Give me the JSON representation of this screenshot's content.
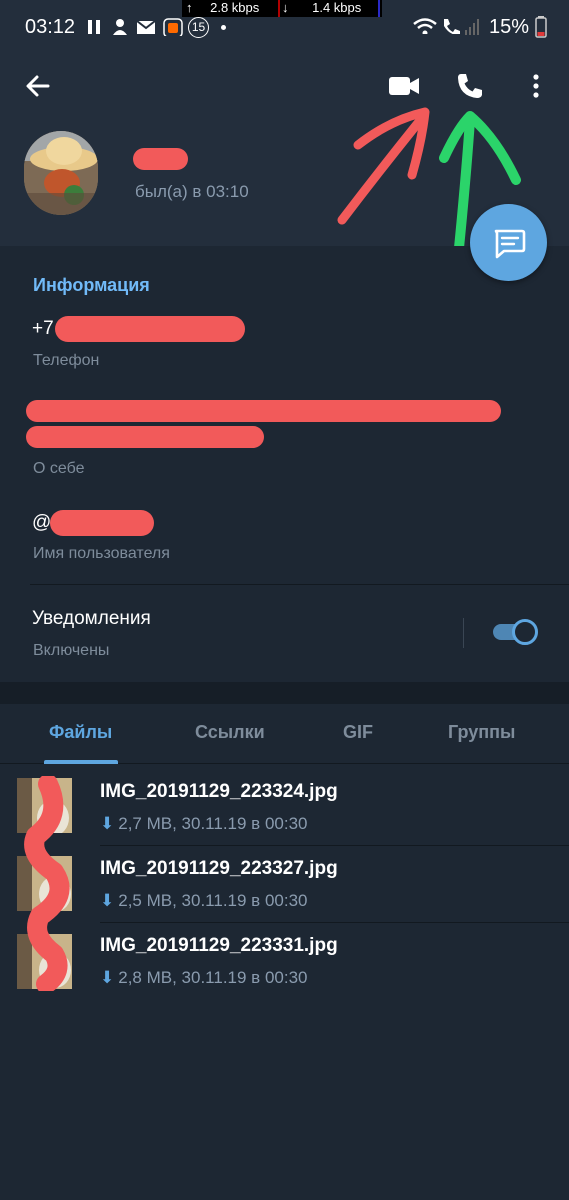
{
  "status_bar": {
    "time": "03:12",
    "upload_speed": "2.8 kbps",
    "download_speed": "1.4 kbps",
    "notification_count": "15",
    "battery": "15%"
  },
  "header": {
    "back_icon": "arrow-left-icon",
    "video_call_icon": "video-camera-icon",
    "voice_call_icon": "phone-icon",
    "more_icon": "more-vertical-icon",
    "last_seen": "был(а) в 03:10"
  },
  "info": {
    "section_title": "Информация",
    "phone_value": "+7",
    "phone_label": "Телефон",
    "bio_label": "О себе",
    "username_value": "@",
    "username_label": "Имя пользователя",
    "notifications_title": "Уведомления",
    "notifications_status": "Включены",
    "notifications_enabled": true
  },
  "tabs": [
    {
      "label": "Файлы",
      "active": true
    },
    {
      "label": "Ссылки",
      "active": false
    },
    {
      "label": "GIF",
      "active": false
    },
    {
      "label": "Группы",
      "active": false
    }
  ],
  "files": [
    {
      "name": "IMG_20191129_223324.jpg",
      "meta": "2,7 MB, 30.11.19 в 00:30"
    },
    {
      "name": "IMG_20191129_223327.jpg",
      "meta": "2,5 MB, 30.11.19 в 00:30"
    },
    {
      "name": "IMG_20191129_223331.jpg",
      "meta": "2,8 MB, 30.11.19 в 00:30"
    }
  ],
  "colors": {
    "background": "#1d2733",
    "header": "#232e3c",
    "accent": "#5ea6e0",
    "section_title": "#71baf8",
    "secondary_text": "#7e8c9b",
    "annotation_red": "#f25a5a",
    "annotation_green": "#2bd46a"
  }
}
